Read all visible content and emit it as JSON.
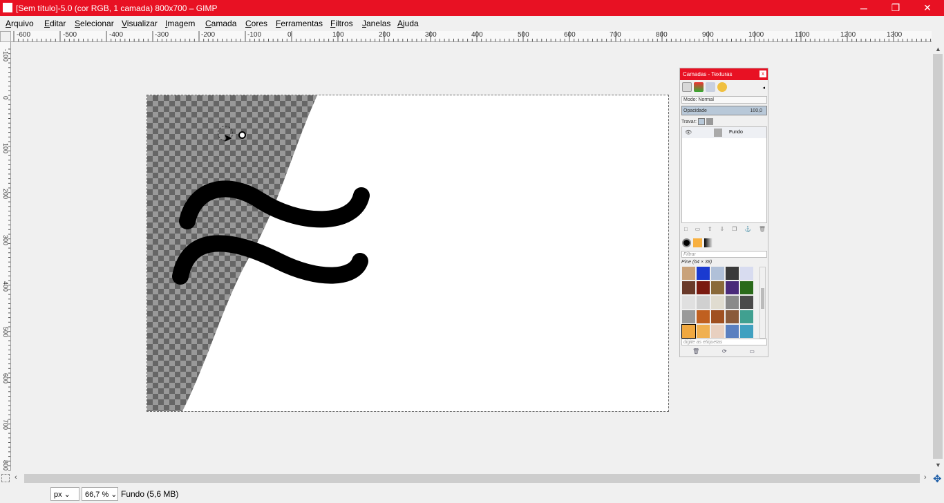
{
  "window": {
    "title": "[Sem título]-5.0 (cor RGB, 1 camada) 800x700 – GIMP",
    "minimize": "─",
    "maximize": "❐",
    "close": "✕"
  },
  "menu": {
    "items": [
      {
        "first": "A",
        "rest": "rquivo"
      },
      {
        "first": "E",
        "rest": "ditar"
      },
      {
        "first": "S",
        "rest": "elecionar"
      },
      {
        "first": "V",
        "rest": "isualizar"
      },
      {
        "first": "I",
        "rest": "magem"
      },
      {
        "first": "C",
        "rest": "amada"
      },
      {
        "first": "C",
        "rest": "ores"
      },
      {
        "first": "F",
        "rest": "erramentas"
      },
      {
        "first": "F",
        "rest": "iltros"
      },
      {
        "first": "J",
        "rest": "anelas"
      },
      {
        "first": "A",
        "rest": "juda"
      }
    ]
  },
  "ruler": {
    "h_labels": [
      "-600",
      "-500",
      "-400",
      "-300",
      "-200",
      "-100",
      "0",
      "100",
      "200",
      "300",
      "400",
      "500",
      "600",
      "700",
      "800",
      "900",
      "1000",
      "1100",
      "1200",
      "1300"
    ],
    "v_labels": [
      "-100",
      "0",
      "100",
      "200",
      "300",
      "400",
      "500",
      "600",
      "700",
      "800"
    ]
  },
  "status": {
    "unit": "px",
    "zoom": "66,7 %",
    "info": "Fundo (5,6 MB)"
  },
  "dock": {
    "title": "Camadas - Texturas",
    "close": "x",
    "mode_label": "Modo: Normal",
    "opacity_label": "Opacidade",
    "opacity_value": "100,0",
    "lock_label": "Travar:",
    "layer_name": "Fundo",
    "filter_placeholder": "Filtrar",
    "texture_name": "Pine (64 × 38)",
    "tags_placeholder": "digite as etiquetas"
  },
  "colors": {
    "titlebar": "#e81123",
    "checker_dark": "#666666",
    "checker_light": "#999999",
    "stroke": "#000000"
  }
}
